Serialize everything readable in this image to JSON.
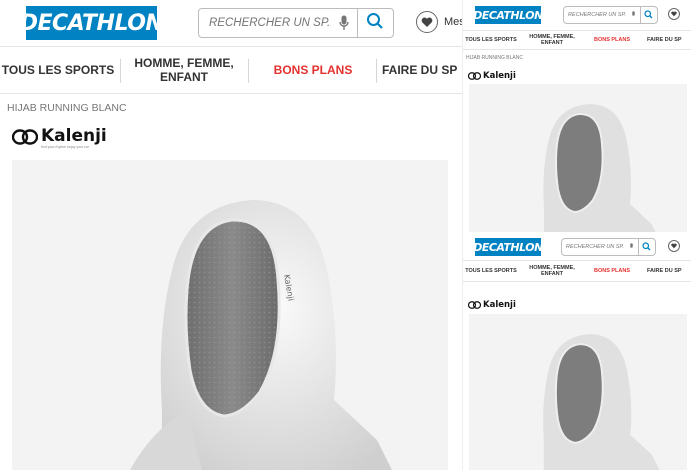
{
  "header": {
    "logo_text": "DECATHLON",
    "search_placeholder": "RECHERCHER UN SP...",
    "wishlist_label": "Mes"
  },
  "nav": {
    "items": [
      {
        "label": "TOUS LES SPORTS"
      },
      {
        "label": "HOMME, FEMME, ENFANT"
      },
      {
        "label": "BONS PLANS"
      },
      {
        "label": "FAIRE DU SP"
      }
    ]
  },
  "breadcrumb": "HIJAB RUNNING BLANC",
  "brand": {
    "name": "Kalenji",
    "tagline": "find your rhythm enjoy your run"
  },
  "colors": {
    "brand_blue": "#0082c3",
    "promo_red": "#e4312f",
    "nav_text": "#333333"
  },
  "icons": [
    "search-icon",
    "mic-icon",
    "heart-icon",
    "kalenji-logo-icon"
  ]
}
